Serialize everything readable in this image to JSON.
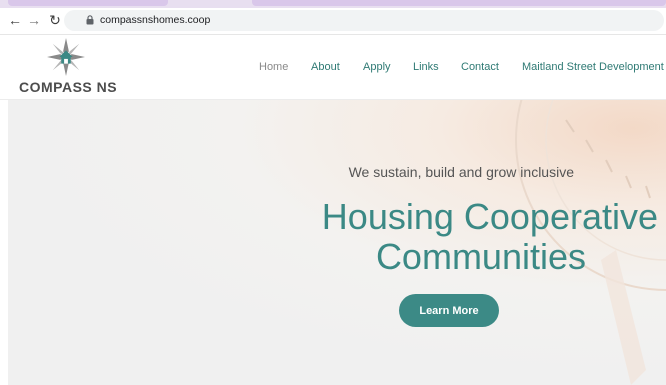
{
  "browser": {
    "url": "compassnshomes.coop"
  },
  "site": {
    "logo_text": "COMPASS NS",
    "nav": [
      {
        "label": "Home"
      },
      {
        "label": "About"
      },
      {
        "label": "Apply"
      },
      {
        "label": "Links"
      },
      {
        "label": "Contact"
      },
      {
        "label": "Maitland Street Development"
      }
    ]
  },
  "hero": {
    "subtitle": "We sustain, build and grow inclusive",
    "heading_line1": "Housing Cooperative",
    "heading_line2": "Communities",
    "cta_label": "Learn More"
  },
  "colors": {
    "brand_teal": "#3b8985",
    "nav_teal": "#2f7a74"
  }
}
